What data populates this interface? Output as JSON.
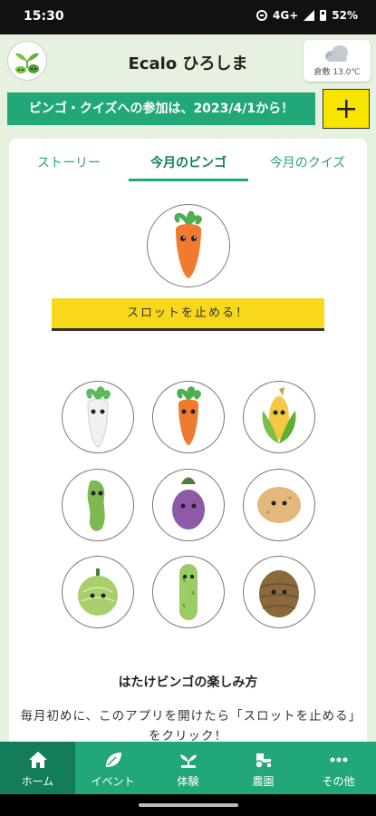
{
  "status_bar": {
    "time": "15:30",
    "network": "4G+",
    "battery": "52%"
  },
  "header": {
    "app_title": "Ecalo ひろしま",
    "weather_text": "倉敷 13.0℃"
  },
  "banner": {
    "text": "ビンゴ・クイズへの参加は、2023/4/1から！",
    "plus_label": "+"
  },
  "tabs": [
    {
      "label": "ストーリー",
      "active": false
    },
    {
      "label": "今月のビンゴ",
      "active": true
    },
    {
      "label": "今月のクイズ",
      "active": false
    }
  ],
  "bingo": {
    "slot_button": "スロットを止める！",
    "current_vegetable": "carrot",
    "grid": [
      "radish",
      "carrot",
      "corn",
      "edamame",
      "eggplant",
      "potato",
      "melon",
      "cucumber",
      "taro"
    ]
  },
  "how_to": {
    "title": "はたけビンゴの楽しみ方",
    "text": "毎月初めに、このアプリを開けたら「スロットを止める」をクリック！"
  },
  "nav": [
    {
      "label": "ホーム",
      "icon": "home-icon",
      "active": true
    },
    {
      "label": "イベント",
      "icon": "leaf-icon",
      "active": false
    },
    {
      "label": "体験",
      "icon": "sprout-icon",
      "active": false
    },
    {
      "label": "農園",
      "icon": "tractor-icon",
      "active": false
    },
    {
      "label": "その他",
      "icon": "more-icon",
      "active": false
    }
  ],
  "colors": {
    "brand_green": "#22a878",
    "dark_green": "#127d58",
    "yellow": "#f7d81a",
    "background": "#e6f1df"
  }
}
